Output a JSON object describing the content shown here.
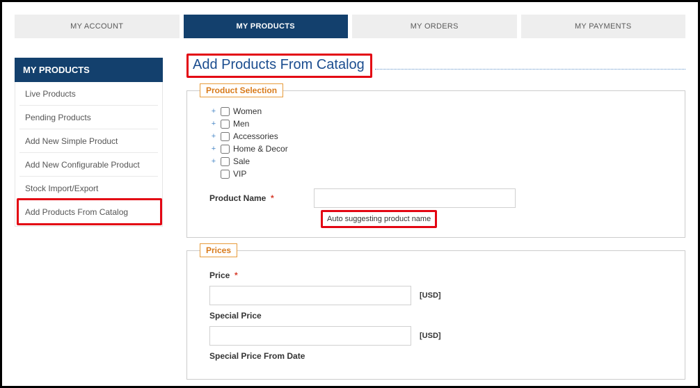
{
  "tabs": {
    "account": "MY ACCOUNT",
    "products": "MY PRODUCTS",
    "orders": "MY ORDERS",
    "payments": "MY PAYMENTS"
  },
  "sidebar": {
    "header": "MY PRODUCTS",
    "items": [
      "Live Products",
      "Pending Products",
      "Add New Simple Product",
      "Add New Configurable Product",
      "Stock Import/Export",
      "Add Products From Catalog"
    ]
  },
  "page": {
    "title": "Add Products From Catalog"
  },
  "product_selection": {
    "legend": "Product Selection",
    "categories": [
      {
        "label": "Women",
        "expandable": true
      },
      {
        "label": "Men",
        "expandable": true
      },
      {
        "label": "Accessories",
        "expandable": true
      },
      {
        "label": "Home & Decor",
        "expandable": true
      },
      {
        "label": "Sale",
        "expandable": true
      },
      {
        "label": "VIP",
        "expandable": false
      }
    ],
    "product_name_label": "Product Name",
    "required_mark": "*",
    "hint": "Auto suggesting product name"
  },
  "prices": {
    "legend": "Prices",
    "price_label": "Price",
    "currency": "[USD]",
    "special_price_label": "Special Price",
    "special_price_from_label": "Special Price From Date"
  }
}
